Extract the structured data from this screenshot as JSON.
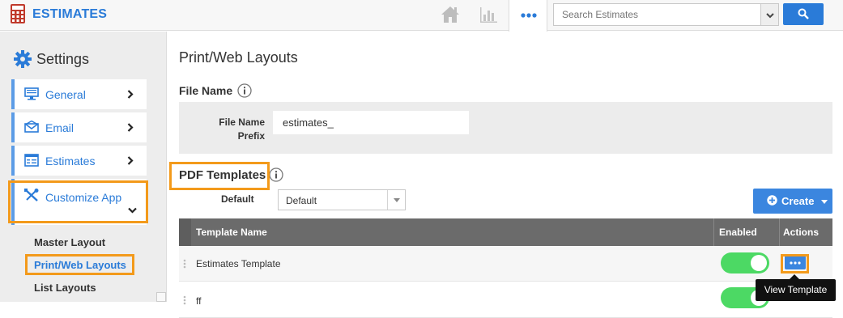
{
  "app": {
    "title": "ESTIMATES",
    "logo_icon": "calculator-icon",
    "accent": "#2a7bd8"
  },
  "topbar": {
    "home_icon": "home-icon",
    "reports_icon": "bar-chart-icon",
    "more_icon": "more-dots-icon",
    "search": {
      "placeholder": "Search Estimates",
      "value": ""
    }
  },
  "sidebar": {
    "heading": "Settings",
    "items": [
      {
        "label": "General",
        "icon": "monitor-icon"
      },
      {
        "label": "Email",
        "icon": "envelope-icon"
      },
      {
        "label": "Estimates",
        "icon": "form-icon"
      },
      {
        "label": "Customize App",
        "icon": "tools-icon"
      }
    ],
    "subitems": [
      {
        "label": "Master Layout"
      },
      {
        "label": "Print/Web Layouts",
        "active": true
      },
      {
        "label": "List Layouts"
      }
    ]
  },
  "main": {
    "title": "Print/Web Layouts",
    "file_name": {
      "heading": "File Name",
      "prefix_label": "File Name Prefix",
      "prefix_value": "estimates_"
    },
    "pdf_templates": {
      "heading": "PDF Templates",
      "default_label": "Default",
      "default_value": "Default",
      "create_label": "Create",
      "columns": {
        "name": "Template Name",
        "enabled": "Enabled",
        "actions": "Actions"
      },
      "rows": [
        {
          "name": "Estimates Template",
          "enabled": true
        },
        {
          "name": "ff",
          "enabled": true
        }
      ],
      "tooltip": "View Template"
    }
  },
  "colors": {
    "highlight": "#f39a1b",
    "toggle_on": "#4cd964",
    "button": "#3b86df"
  }
}
